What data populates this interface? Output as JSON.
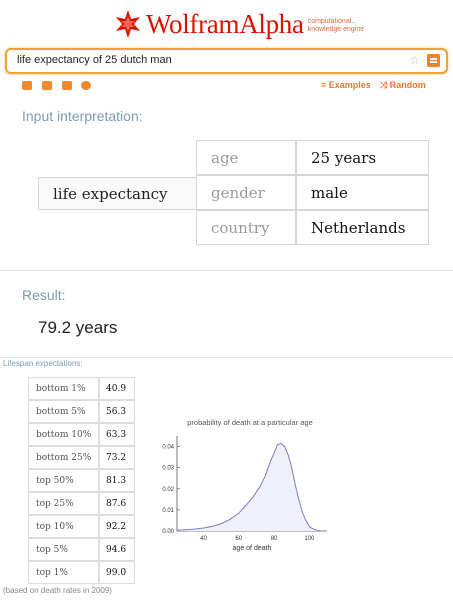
{
  "header": {
    "brand": "WolframAlpha",
    "tagline_1": "computational...",
    "tagline_2": "knowledge engine",
    "logo_color": "#dd1100"
  },
  "search": {
    "query": "life expectancy of 25 dutch man",
    "favorite_icon": "star-icon",
    "submit_icon": "equals-icon"
  },
  "toolbar": {
    "icons": [
      "keyboard-icon",
      "image-upload-icon",
      "data-upload-icon",
      "camera-icon"
    ],
    "examples_label": "Examples",
    "random_label": "Random",
    "accent": "#e5782f"
  },
  "input_interpretation": {
    "title": "Input interpretation:",
    "label": "life expectancy",
    "rows": [
      {
        "key": "age",
        "value": "25 years"
      },
      {
        "key": "gender",
        "value": "male"
      },
      {
        "key": "country",
        "value": "Netherlands"
      }
    ]
  },
  "result": {
    "title": "Result:",
    "value": "79.2 years"
  },
  "lifespan": {
    "title": "Lifespan expectations:",
    "rows": [
      {
        "key": "bottom 1%",
        "value": "40.9"
      },
      {
        "key": "bottom 5%",
        "value": "56.3"
      },
      {
        "key": "bottom 10%",
        "value": "63.3"
      },
      {
        "key": "bottom 25%",
        "value": "73.2"
      },
      {
        "key": "top 50%",
        "value": "81.3"
      },
      {
        "key": "top 25%",
        "value": "87.6"
      },
      {
        "key": "top 10%",
        "value": "92.2"
      },
      {
        "key": "top 5%",
        "value": "94.6"
      },
      {
        "key": "top 1%",
        "value": "99.0"
      }
    ],
    "footnote": "(based on death rates in 2009)"
  },
  "chart_data": {
    "type": "area",
    "title": "probability of death at a particular age",
    "xlabel": "age of death",
    "ylabel": "",
    "xlim": [
      25,
      110
    ],
    "ylim": [
      0,
      0.045
    ],
    "xticks": [
      40,
      60,
      80,
      100
    ],
    "yticks": [
      0.0,
      0.01,
      0.02,
      0.03,
      0.04
    ],
    "ytick_labels": [
      "0.00",
      "0.01",
      "0.02",
      "0.03",
      "0.04"
    ],
    "line_color": "#7b7bc7",
    "fill_color": "#eef0fa",
    "series": [
      {
        "x": [
          25,
          30,
          35,
          40,
          45,
          50,
          55,
          60,
          65,
          68,
          72,
          75,
          78,
          80,
          82,
          84,
          86,
          88,
          90,
          92,
          94,
          96,
          98,
          100,
          103,
          106
        ],
        "y": [
          0.0004,
          0.0006,
          0.0009,
          0.0014,
          0.0022,
          0.0035,
          0.0055,
          0.0085,
          0.013,
          0.016,
          0.021,
          0.026,
          0.033,
          0.037,
          0.041,
          0.0415,
          0.04,
          0.036,
          0.03,
          0.022,
          0.015,
          0.009,
          0.005,
          0.002,
          0.0006,
          0.0001
        ]
      }
    ]
  }
}
